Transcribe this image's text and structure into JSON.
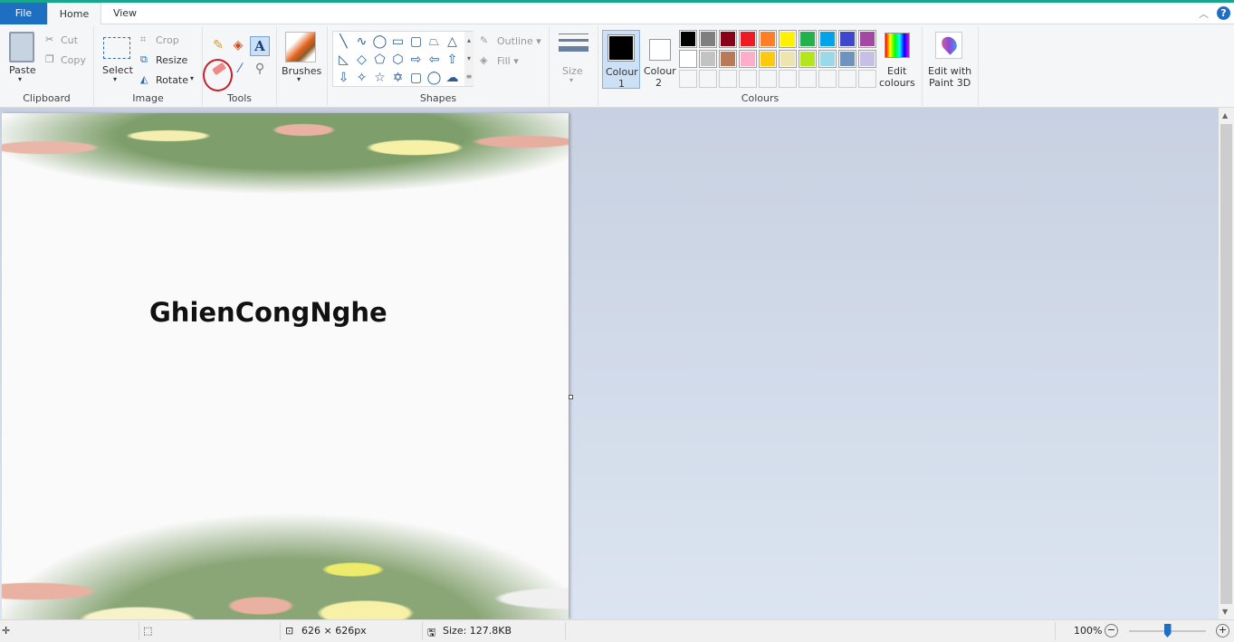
{
  "tabs": {
    "file": "File",
    "home": "Home",
    "view": "View"
  },
  "clipboard": {
    "paste": "Paste",
    "cut": "Cut",
    "copy": "Copy",
    "label": "Clipboard"
  },
  "image": {
    "select": "Select",
    "crop": "Crop",
    "resize": "Resize",
    "rotate": "Rotate",
    "label": "Image"
  },
  "tools": {
    "label": "Tools",
    "items": [
      "pencil-icon",
      "fill-icon",
      "text-icon",
      "eraser-icon",
      "colour-picker-icon",
      "magnifier-icon"
    ],
    "selected": "eraser"
  },
  "brushes": {
    "label": "Brushes"
  },
  "shapes": {
    "label": "Shapes",
    "outline": "Outline",
    "fill": "Fill",
    "glyphs": [
      "╲",
      "∿",
      "◯",
      "▭",
      "▢",
      "⏢",
      "△",
      "◺",
      "◇",
      "⬠",
      "⬡",
      "⇨",
      "⇦",
      "⇧",
      "⇩",
      "✧",
      "☆",
      "✡",
      "▢",
      "◯",
      "☁"
    ]
  },
  "size": {
    "label": "Size"
  },
  "colours": {
    "label": "Colours",
    "colour1": "Colour",
    "colour1_num": "1",
    "colour2": "Colour",
    "colour2_num": "2",
    "edit": "Edit",
    "edit2": "colours",
    "colour1_value": "#000000",
    "colour2_value": "#ffffff",
    "palette_row1": [
      "#000000",
      "#7f7f7f",
      "#880015",
      "#ed1c24",
      "#ff7f27",
      "#fff200",
      "#22b14c",
      "#00a2e8",
      "#3f48cc",
      "#a349a4"
    ],
    "palette_row2": [
      "#ffffff",
      "#c3c3c3",
      "#b97a57",
      "#ffaec9",
      "#ffc90e",
      "#efe4b0",
      "#b5e61d",
      "#99d9ea",
      "#7092be",
      "#c8bfe7"
    ]
  },
  "paint3d": {
    "line1": "Edit with",
    "line2": "Paint 3D"
  },
  "canvas": {
    "text": "GhienCongNghe"
  },
  "status": {
    "dimensions": "626 × 626px",
    "size": "Size: 127.8KB",
    "zoom": "100%",
    "zoom_level": 100
  }
}
